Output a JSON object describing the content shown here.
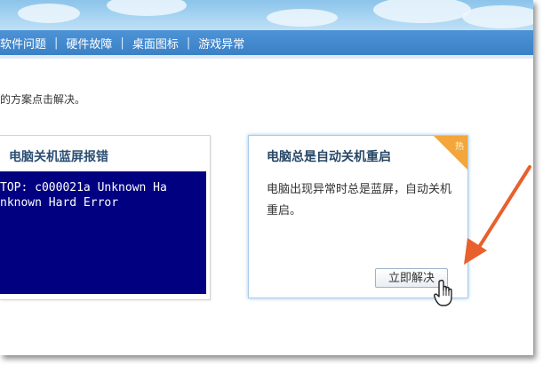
{
  "nav": {
    "items": [
      "软件问题",
      "硬件故障",
      "桌面图标",
      "游戏异常"
    ],
    "separator": "|"
  },
  "instruction": "的方案点击解决。",
  "cards": {
    "left": {
      "title": "电脑关机蓝屏报错",
      "error_lines": [
        "TOP: c000021a Unknown Ha",
        "nknown Hard Error"
      ]
    },
    "right": {
      "title": "电脑总是自动关机重启",
      "description": "电脑出现异常时总是蓝屏，自动关机重启。",
      "badge": "热",
      "button": "立即解决"
    }
  },
  "colors": {
    "nav_bg": "#3f86cc",
    "bsod_bg": "#000080",
    "badge": "#f3a63b",
    "arrow": "#e8602c"
  },
  "icons": {
    "pointer": "hand-pointer-icon",
    "annotation": "annotation-arrow"
  }
}
